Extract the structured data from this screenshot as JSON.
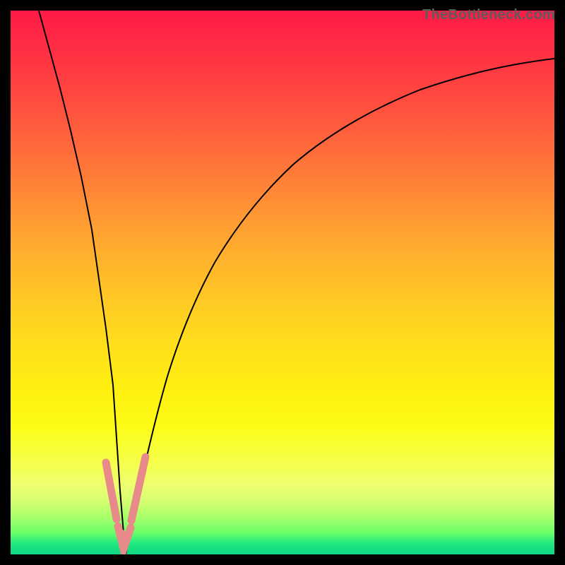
{
  "watermark": "TheBottleneck.com",
  "chart_data": {
    "type": "line",
    "title": "",
    "xlabel": "",
    "ylabel": "",
    "xlim": [
      0,
      100
    ],
    "ylim": [
      0,
      100
    ],
    "grid": false,
    "legend": false,
    "background": {
      "kind": "vertical-gradient",
      "stops": [
        {
          "pos": 0,
          "color": "#ff1a47"
        },
        {
          "pos": 50,
          "color": "#ffcb24"
        },
        {
          "pos": 80,
          "color": "#f8ff32"
        },
        {
          "pos": 100,
          "color": "#0fd884"
        }
      ]
    },
    "series": [
      {
        "name": "left-branch",
        "stroke": "#000000",
        "x": [
          5,
          6,
          7,
          8,
          10,
          12,
          14,
          16,
          18,
          19,
          20,
          21
        ],
        "y": [
          100,
          93,
          86,
          80,
          67,
          54,
          41,
          28,
          14,
          8,
          3,
          0
        ]
      },
      {
        "name": "right-branch",
        "stroke": "#000000",
        "x": [
          21,
          22,
          23,
          24,
          26,
          28,
          30,
          33,
          36,
          40,
          45,
          50,
          55,
          60,
          66,
          72,
          80,
          88,
          95,
          100
        ],
        "y": [
          0,
          4,
          9,
          14,
          24,
          32,
          39,
          48,
          55,
          62,
          68,
          73,
          76,
          79,
          82,
          84,
          86.5,
          88.5,
          90,
          91
        ]
      },
      {
        "name": "markers-left-outer",
        "stroke": "#e98a8a",
        "marker": "round",
        "x": [
          17.5,
          18.0,
          18.5,
          19.0,
          19.5
        ],
        "y": [
          17,
          14,
          11,
          8,
          5
        ]
      },
      {
        "name": "markers-right-outer",
        "stroke": "#e98a8a",
        "marker": "round",
        "x": [
          22.0,
          22.5,
          23.0,
          23.5,
          24.0,
          24.5
        ],
        "y": [
          5,
          8,
          11,
          14,
          16,
          18
        ]
      },
      {
        "name": "markers-bottom-v",
        "stroke": "#e98a8a",
        "marker": "round",
        "x": [
          19.7,
          20.0,
          20.5,
          21.0,
          21.3,
          21.6
        ],
        "y": [
          5,
          3,
          1,
          0,
          2,
          4
        ]
      }
    ]
  }
}
